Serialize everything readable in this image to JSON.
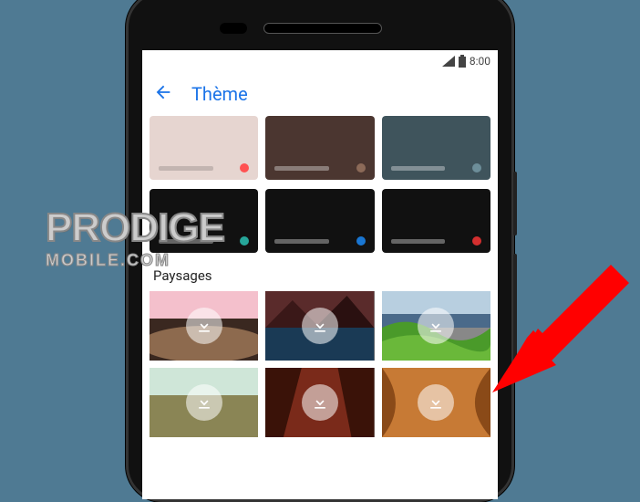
{
  "statusbar": {
    "signal": "LTE",
    "battery": 100,
    "time": "8:00"
  },
  "appbar": {
    "title": "Thème"
  },
  "swatches": {
    "row1": [
      {
        "bg": "#e6d5d0",
        "dot": "#ff5252"
      },
      {
        "bg": "#4b3630",
        "dot": "#8c6a58"
      },
      {
        "bg": "#3f545c",
        "dot": "#6d8e99"
      }
    ],
    "row2": [
      {
        "bg": "#111111",
        "dot": "#26a69a"
      },
      {
        "bg": "#111111",
        "dot": "#1976d2"
      },
      {
        "bg": "#111111",
        "dot": "#d32f2f"
      }
    ]
  },
  "section": {
    "title": "Paysages"
  },
  "watermark": {
    "line1": "PRODIGE",
    "line2": "MOBILE.COM"
  }
}
